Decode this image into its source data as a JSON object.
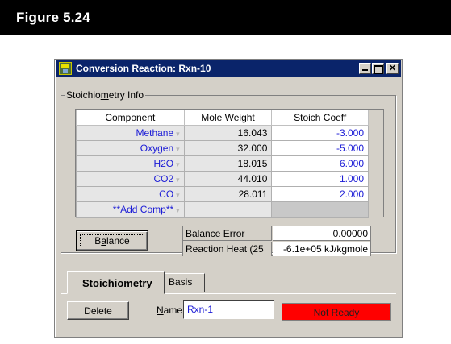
{
  "figure": {
    "title": "Figure 5.24"
  },
  "window": {
    "title": "Conversion Reaction: Rxn-10",
    "close_glyph": "✕"
  },
  "stoich_group": {
    "label_before": "Stoichio",
    "label_accel": "m",
    "label_after": "etry Info"
  },
  "table": {
    "headers": [
      "Component",
      "Mole Weight",
      "Stoich Coeff"
    ],
    "rows": [
      {
        "component": "Methane",
        "mole_weight": "16.043",
        "stoich_coeff": "-3.000"
      },
      {
        "component": "Oxygen",
        "mole_weight": "32.000",
        "stoich_coeff": "-5.000"
      },
      {
        "component": "H2O",
        "mole_weight": "18.015",
        "stoich_coeff": "6.000"
      },
      {
        "component": "CO2",
        "mole_weight": "44.010",
        "stoich_coeff": "1.000"
      },
      {
        "component": "CO",
        "mole_weight": "28.011",
        "stoich_coeff": "2.000"
      },
      {
        "component": "**Add Comp**",
        "mole_weight": "",
        "stoich_coeff": ""
      }
    ],
    "dropdown_glyph": "▾"
  },
  "balance_button": {
    "label_before": "B",
    "label_accel": "a",
    "label_after": "lance"
  },
  "balance_info": {
    "error_label": "Balance Error",
    "error_value": "0.00000",
    "heat_label": "Reaction Heat (25",
    "heat_value": "-6.1e+05 kJ/kgmole"
  },
  "tabs": {
    "active": "Stoichiometry",
    "inactive": "Basis"
  },
  "footer": {
    "delete_label": "Delete",
    "name_label_accel": "N",
    "name_label_rest": "ame",
    "name_value": "Rxn-1",
    "status_text": "Not Ready",
    "status_color": "#ff0000"
  }
}
